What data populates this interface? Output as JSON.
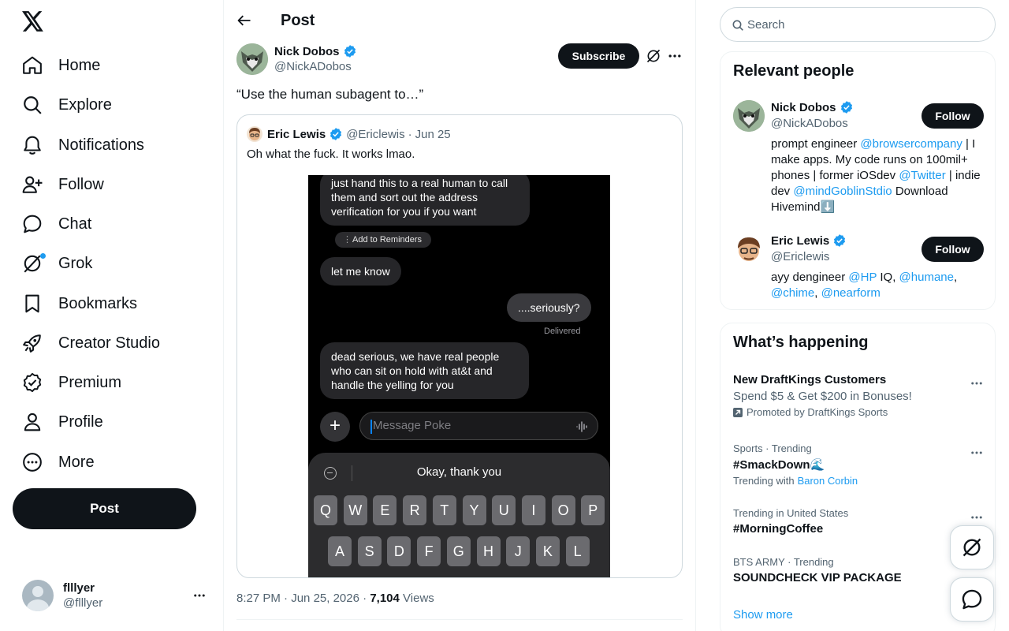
{
  "nav": {
    "items": [
      {
        "label": "Home",
        "icon": "home-icon"
      },
      {
        "label": "Explore",
        "icon": "search-icon"
      },
      {
        "label": "Notifications",
        "icon": "bell-icon"
      },
      {
        "label": "Follow",
        "icon": "person-add-icon"
      },
      {
        "label": "Chat",
        "icon": "chat-icon"
      },
      {
        "label": "Grok",
        "icon": "grok-icon"
      },
      {
        "label": "Bookmarks",
        "icon": "bookmark-icon"
      },
      {
        "label": "Creator Studio",
        "icon": "rocket-icon"
      },
      {
        "label": "Premium",
        "icon": "verified-badge-icon"
      },
      {
        "label": "Profile",
        "icon": "person-icon"
      },
      {
        "label": "More",
        "icon": "more-circle-icon"
      }
    ],
    "post_button": "Post",
    "account": {
      "name": "flllyer",
      "handle": "@flllyer"
    }
  },
  "header": {
    "title": "Post"
  },
  "post": {
    "author_name": "Nick Dobos",
    "author_handle": "@NickADobos",
    "subscribe_label": "Subscribe",
    "text": "“Use the human subagent to…”",
    "quote": {
      "name": "Eric Lewis",
      "handle": "@Ericlewis",
      "date": "Jun 25",
      "text": "Oh what the fuck. It works lmao.",
      "image": {
        "bubble1": "just hand this to a real human to call them and sort out the address verification for you if you want",
        "reminders": "Add to Reminders",
        "bubble2": "let me know",
        "bubble3": "....seriously?",
        "delivered": "Delivered",
        "bubble4": "dead serious, we have real people who can sit on hold with at&t and handle the yelling for you",
        "message_placeholder": "Message Poke",
        "suggestion": "Okay, thank you",
        "keys_row1": [
          "Q",
          "W",
          "E",
          "R",
          "T",
          "Y",
          "U",
          "I",
          "O",
          "P"
        ],
        "keys_row2": [
          "A",
          "S",
          "D",
          "F",
          "G",
          "H",
          "J",
          "K",
          "L"
        ]
      }
    },
    "time": "8:27 PM",
    "date": "Jun 25, 2026",
    "views_count": "7,104",
    "views_label": "Views"
  },
  "search": {
    "placeholder": "Search"
  },
  "relevant": {
    "title": "Relevant people",
    "follow_label": "Follow",
    "people": [
      {
        "name": "Nick Dobos",
        "handle": "@NickADobos",
        "bio": [
          {
            "t": "prompt engineer "
          },
          {
            "t": "@browsercompany",
            "link": true
          },
          {
            "t": " | I make apps. My code runs on 100mil+ phones | former iOSdev "
          },
          {
            "t": "@Twitter",
            "link": true
          },
          {
            "t": " | indie dev "
          },
          {
            "t": "@mindGoblinStdio",
            "link": true
          },
          {
            "t": " Download Hivemind⬇️"
          }
        ]
      },
      {
        "name": "Eric Lewis",
        "handle": "@Ericlewis",
        "bio": [
          {
            "t": "ayy dengineer "
          },
          {
            "t": "@HP",
            "link": true
          },
          {
            "t": " IQ, "
          },
          {
            "t": "@humane",
            "link": true
          },
          {
            "t": ", "
          },
          {
            "t": "@chime",
            "link": true
          },
          {
            "t": ", "
          },
          {
            "t": "@nearform",
            "link": true
          }
        ]
      }
    ]
  },
  "happening": {
    "title": "What’s happening",
    "promo": {
      "title": "New DraftKings Customers",
      "desc": "Spend $5 & Get $200 in Bonuses!",
      "by": "Promoted by DraftKings Sports"
    },
    "trends": [
      {
        "context": "Sports · Trending",
        "title": "#SmackDown🌊",
        "sub_prefix": "Trending with",
        "sub_link": "Baron Corbin"
      },
      {
        "context": "Trending in United States",
        "title": "#MorningCoffee"
      },
      {
        "context": "BTS ARMY · Trending",
        "title": "SOUNDCHECK VIP PACKAGE"
      }
    ],
    "show_more": "Show more"
  },
  "colors": {
    "accent": "#1d9bf0",
    "text": "#0f1419",
    "muted": "#536471",
    "border": "#eff3f4"
  }
}
